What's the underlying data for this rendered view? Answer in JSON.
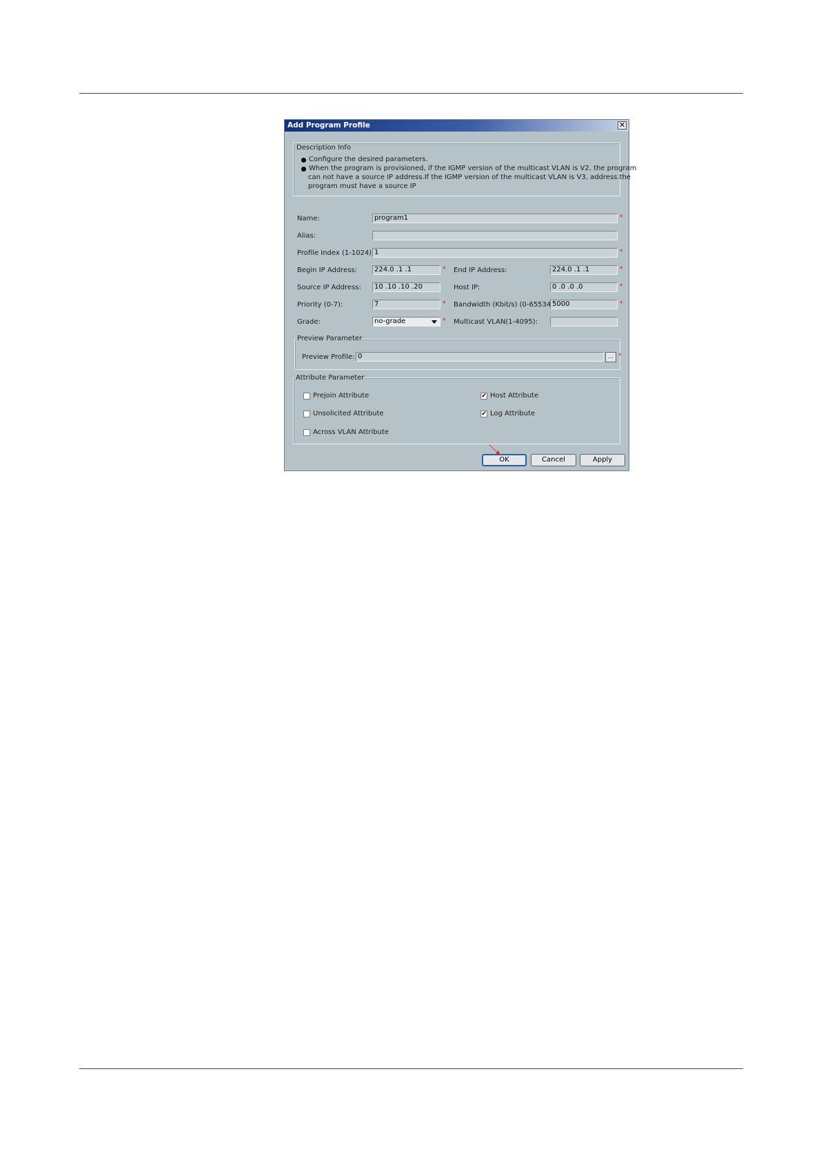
{
  "dialog": {
    "title": "Add Program Profile",
    "close_glyph": "✕"
  },
  "description": {
    "legend": "Description Info",
    "bullets": [
      "Configure the desired parameters.",
      "When the program is provisioned, if the IGMP version of the multicast VLAN is V2, the program can not have a source IP address.If the IGMP version of the multicast VLAN is V3, address.the program must have a source IP"
    ],
    "bullet2_lines": [
      "When the program is provisioned, if the IGMP version of the multicast VLAN is V2, the program",
      "can not have a source IP address.If the IGMP version of the multicast VLAN is V3, address.the",
      "program must have a source IP"
    ]
  },
  "form": {
    "required_mark": "*",
    "name": {
      "label": "Name:",
      "value": "program1"
    },
    "alias": {
      "label": "Alias:",
      "value": ""
    },
    "profile_index": {
      "label": "Profile Index (1-1024):",
      "value": "1"
    },
    "begin_ip": {
      "label": "Begin IP Address:",
      "value": "224.0 .1 .1"
    },
    "end_ip": {
      "label": "End IP Address:",
      "value": "224.0 .1 .1"
    },
    "source_ip": {
      "label": "Source IP Address:",
      "value": "10 .10 .10 .20"
    },
    "host_ip": {
      "label": "Host IP:",
      "value": "0 .0 .0 .0"
    },
    "priority": {
      "label": "Priority (0-7):",
      "value": "7"
    },
    "bandwidth": {
      "label": "Bandwidth (Kbit/s) (0-65534):",
      "value": "5000"
    },
    "grade": {
      "label": "Grade:",
      "value": "no-grade"
    },
    "multicast_vlan": {
      "label": "Multicast VLAN(1-4095):",
      "value": ""
    }
  },
  "preview": {
    "legend": "Preview Parameter",
    "label": "Preview Profile:",
    "value": "0",
    "browse_label": "..."
  },
  "attributes": {
    "legend": "Attribute Parameter",
    "items": [
      {
        "label": "Prejoin Attribute",
        "checked": false
      },
      {
        "label": "Unsolicited Attribute",
        "checked": false
      },
      {
        "label": "Across VLAN Attribute",
        "checked": false
      },
      {
        "label": "Host Attribute",
        "checked": true
      },
      {
        "label": "Log Attribute",
        "checked": true
      }
    ],
    "check_glyph": "✔"
  },
  "buttons": {
    "ok": "OK",
    "cancel": "Cancel",
    "apply": "Apply"
  },
  "colors": {
    "required": "#d21a1a",
    "dialog_bg": "#b5c2c8",
    "title_bar": "#13307d",
    "pointer": "#e02020"
  }
}
